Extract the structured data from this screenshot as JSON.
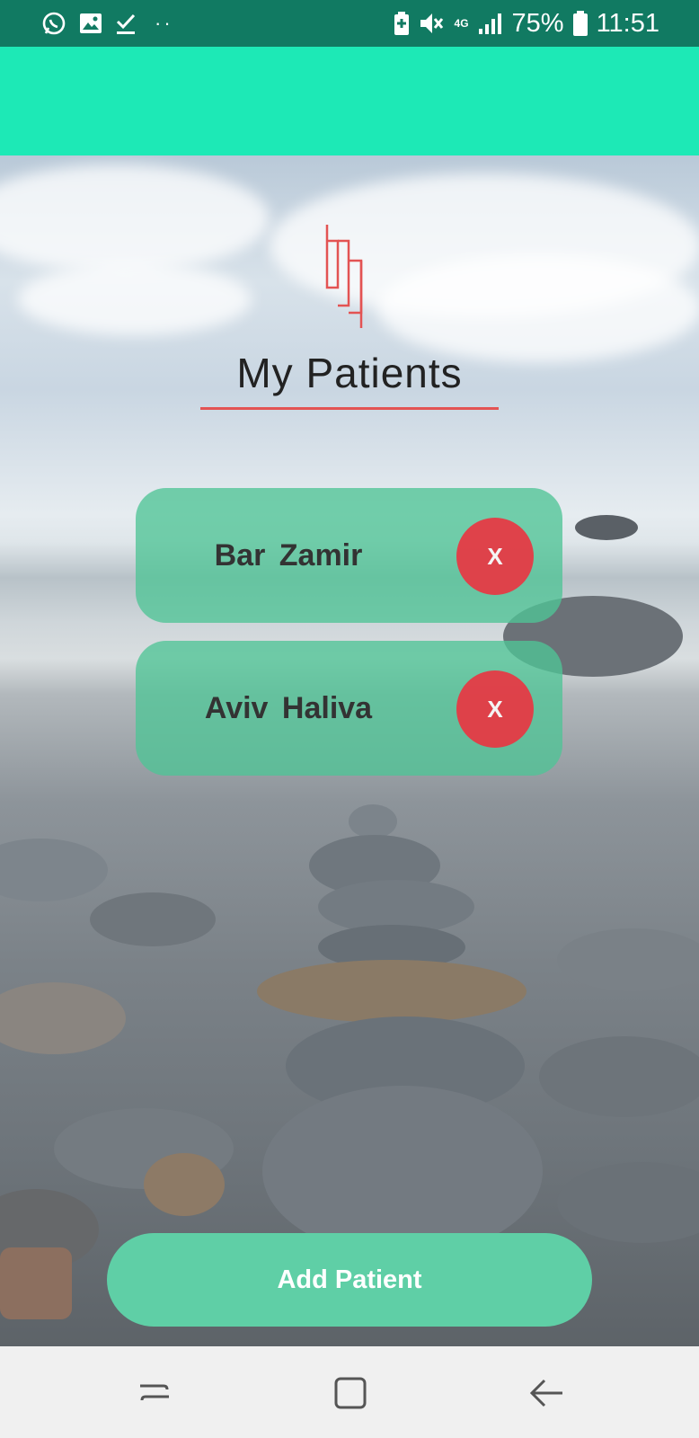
{
  "status_bar": {
    "battery": "75%",
    "time": "11:51",
    "network": "4G",
    "dots": "··",
    "icons": [
      "whatsapp-icon",
      "gallery-icon",
      "download-check-icon",
      "battery-saver-icon",
      "mute-icon",
      "signal-icon",
      "battery-icon"
    ]
  },
  "main": {
    "title": "My Patients",
    "patients": [
      {
        "name": "Bar Zamir",
        "remove_label": "X"
      },
      {
        "name": "Aviv Haliva",
        "remove_label": "X"
      }
    ],
    "add_button_label": "Add Patient"
  },
  "nav": {
    "items": [
      "recent-apps-icon",
      "home-icon",
      "back-icon"
    ]
  },
  "colors": {
    "status_bar": "#117a62",
    "app_bar": "#1de9b6",
    "card": "#50c496",
    "remove": "#e83642",
    "accent_line": "#e35353",
    "add_button": "#5fcfa6"
  }
}
